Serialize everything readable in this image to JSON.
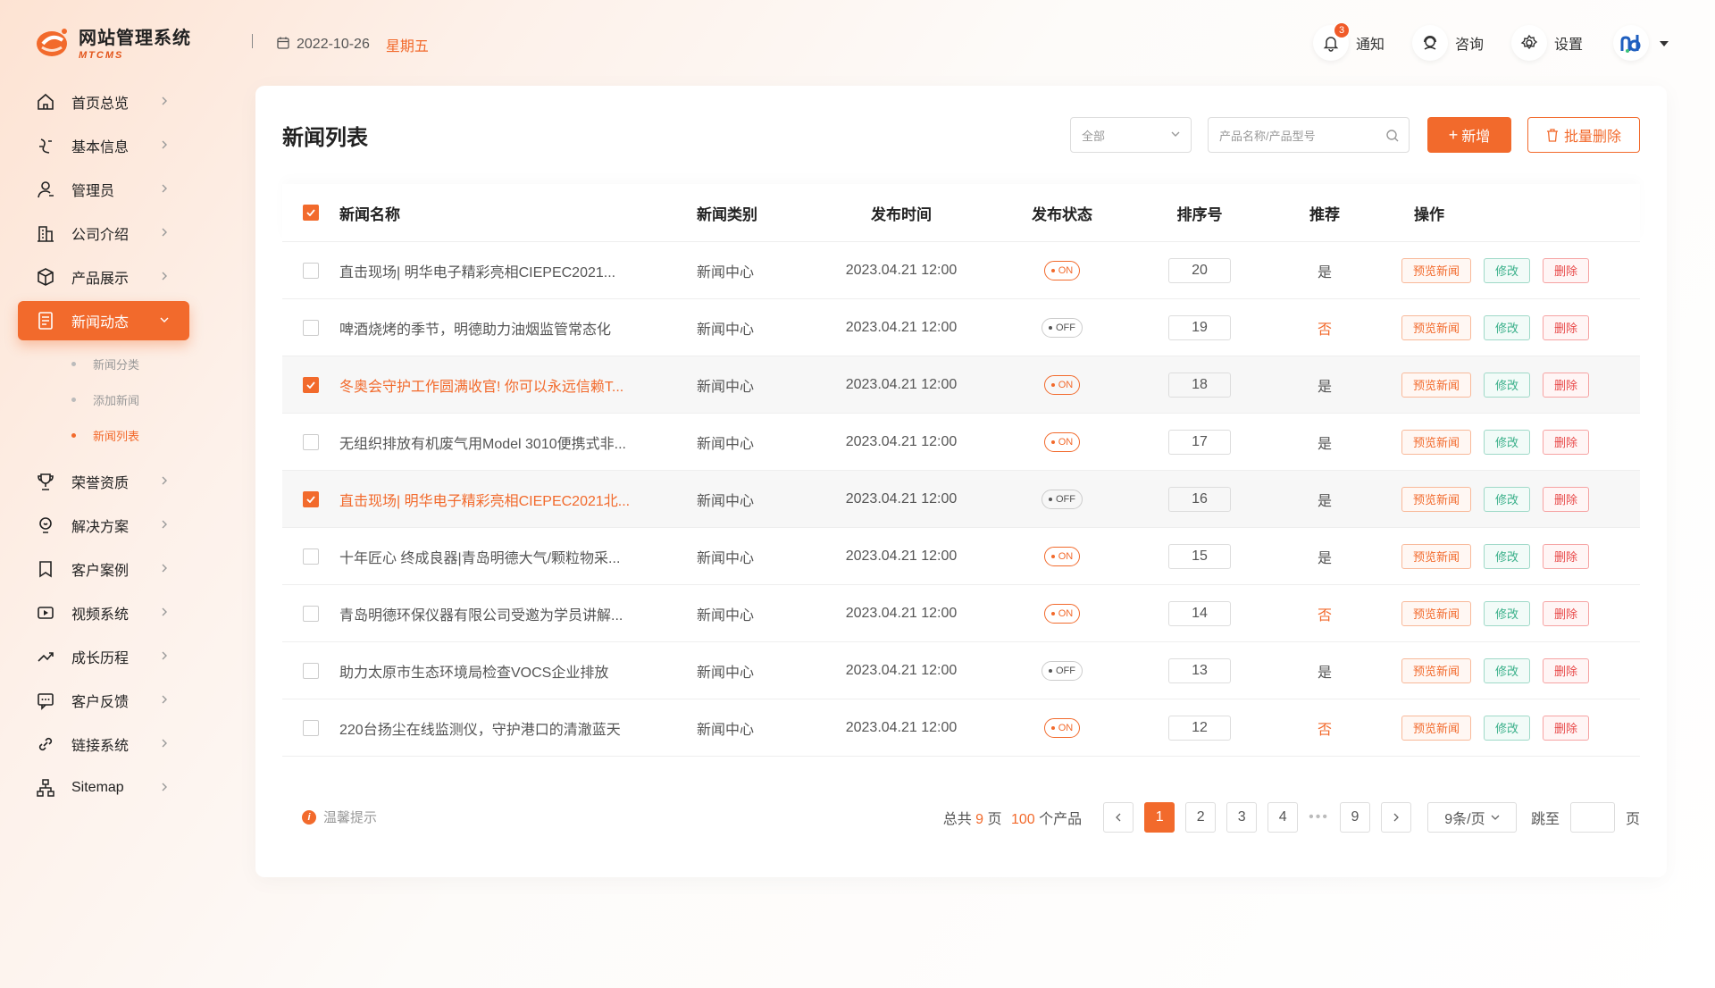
{
  "brand": {
    "title": "网站管理系统",
    "subtitle": "MTCMS",
    "accent": "#f26a2c"
  },
  "header": {
    "separator": "|",
    "date": "2022-10-26",
    "weekday": "星期五",
    "notify_label": "通知",
    "notify_count": "3",
    "consult_label": "咨询",
    "settings_label": "设置"
  },
  "sidebar": {
    "items": [
      {
        "label": "首页总览",
        "icon": "home-icon"
      },
      {
        "label": "基本信息",
        "icon": "info-icon"
      },
      {
        "label": "管理员",
        "icon": "user-icon"
      },
      {
        "label": "公司介绍",
        "icon": "building-icon"
      },
      {
        "label": "产品展示",
        "icon": "box-icon"
      },
      {
        "label": "新闻动态",
        "icon": "news-icon",
        "active": true
      },
      {
        "label": "荣誉资质",
        "icon": "trophy-icon"
      },
      {
        "label": "解决方案",
        "icon": "bulb-icon"
      },
      {
        "label": "客户案例",
        "icon": "bookmark-icon"
      },
      {
        "label": "视频系统",
        "icon": "video-icon"
      },
      {
        "label": "成长历程",
        "icon": "trend-icon"
      },
      {
        "label": "客户反馈",
        "icon": "chat-icon"
      },
      {
        "label": "链接系统",
        "icon": "link-icon"
      },
      {
        "label": "Sitemap",
        "icon": "sitemap-icon"
      }
    ],
    "news_sub": [
      {
        "label": "新闻分类"
      },
      {
        "label": "添加新闻"
      },
      {
        "label": "新闻列表",
        "current": true
      }
    ]
  },
  "main": {
    "title": "新闻列表",
    "filter_value": "全部",
    "search_placeholder": "产品名称/产品型号",
    "add_label": "新增",
    "bulk_delete_label": "批量删除",
    "columns": [
      "新闻名称",
      "新闻类别",
      "发布时间",
      "发布状态",
      "排序号",
      "推荐",
      "操作"
    ],
    "op_labels": {
      "preview": "预览新闻",
      "edit": "修改",
      "delete": "删除"
    },
    "rows": [
      {
        "name": "直击现场| 明华电子精彩亮相CIEPEC2021...",
        "category": "新闻中心",
        "time": "2023.04.21 12:00",
        "status": "ON",
        "sort": "20",
        "recommend": "是",
        "checked": false
      },
      {
        "name": "啤酒烧烤的季节，明德助力油烟监管常态化",
        "category": "新闻中心",
        "time": "2023.04.21 12:00",
        "status": "OFF",
        "sort": "19",
        "recommend": "否",
        "checked": false
      },
      {
        "name": "冬奥会守护工作圆满收官! 你可以永远信赖T...",
        "category": "新闻中心",
        "time": "2023.04.21 12:00",
        "status": "ON",
        "sort": "18",
        "recommend": "是",
        "checked": true
      },
      {
        "name": "无组织排放有机废气用Model 3010便携式非...",
        "category": "新闻中心",
        "time": "2023.04.21 12:00",
        "status": "ON",
        "sort": "17",
        "recommend": "是",
        "checked": false
      },
      {
        "name": "直击现场| 明华电子精彩亮相CIEPEC2021北...",
        "category": "新闻中心",
        "time": "2023.04.21 12:00",
        "status": "OFF",
        "sort": "16",
        "recommend": "是",
        "checked": true
      },
      {
        "name": "十年匠心 终成良器|青岛明德大气/颗粒物采...",
        "category": "新闻中心",
        "time": "2023.04.21 12:00",
        "status": "ON",
        "sort": "15",
        "recommend": "是",
        "checked": false
      },
      {
        "name": "青岛明德环保仪器有限公司受邀为学员讲解...",
        "category": "新闻中心",
        "time": "2023.04.21 12:00",
        "status": "ON",
        "sort": "14",
        "recommend": "否",
        "checked": false
      },
      {
        "name": "助力太原市生态环境局检查VOCS企业排放",
        "category": "新闻中心",
        "time": "2023.04.21 12:00",
        "status": "OFF",
        "sort": "13",
        "recommend": "是",
        "checked": false
      },
      {
        "name": "220台扬尘在线监测仪，守护港口的清澈蓝天",
        "category": "新闻中心",
        "time": "2023.04.21 12:00",
        "status": "ON",
        "sort": "12",
        "recommend": "否",
        "checked": false
      }
    ]
  },
  "footer": {
    "tip": "温馨提示",
    "total_prefix": "总共",
    "total_pages": "9",
    "pages_suffix": "页",
    "total_items": "100",
    "items_suffix": "个产品",
    "pages": [
      "1",
      "2",
      "3",
      "4",
      "9"
    ],
    "current_page": "1",
    "ellipsis": "•••",
    "page_size": "9条/页",
    "jump_label": "跳至",
    "jump_suffix": "页"
  }
}
